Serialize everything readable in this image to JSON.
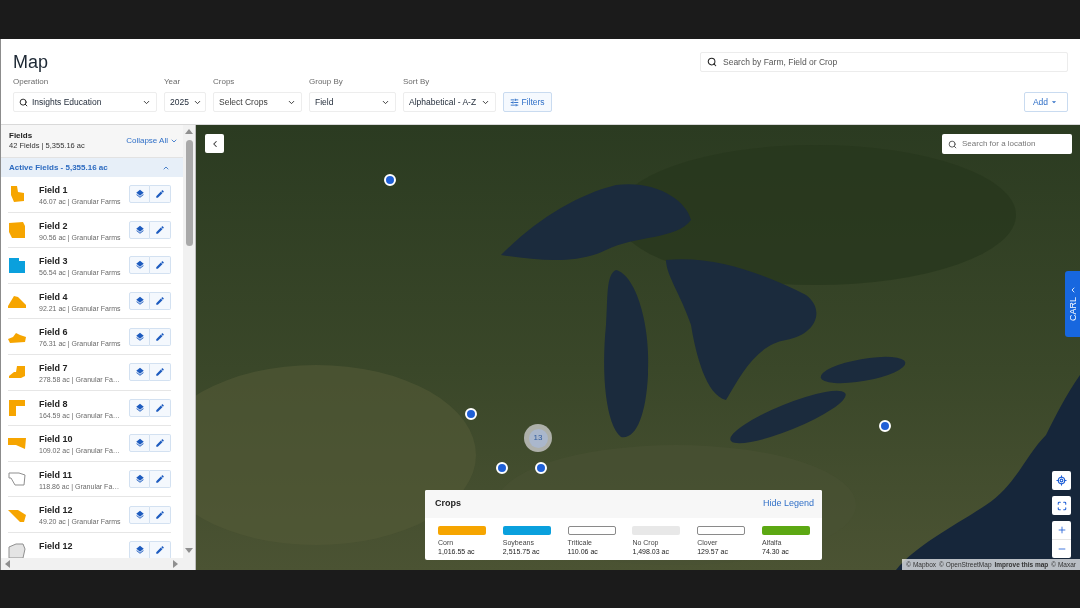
{
  "header": {
    "title": "Map",
    "search": {
      "placeholder": "Search by Farm, Field or Crop"
    },
    "add_button": "Add"
  },
  "filters": [
    {
      "kind": "search-select",
      "label": "Operation",
      "value": "Insights Education"
    },
    {
      "kind": "select",
      "label": "Year",
      "value": "2025"
    },
    {
      "kind": "select",
      "label": "Crops",
      "placeholder": "Select Crops"
    },
    {
      "kind": "select",
      "label": "Group By",
      "value": "Field"
    },
    {
      "kind": "select",
      "label": "Sort By",
      "value": "Alphabetical - A-Z"
    }
  ],
  "filters_button": "Filters",
  "sidebar": {
    "title": "Fields",
    "summary": "42 Fields | 5,355.16 ac",
    "collapse_all": "Collapse All",
    "groups": [
      {
        "label": "Active Fields - 5,355.16 ac",
        "expanded": true,
        "fields": [
          {
            "name": "Field 1",
            "details": "46.07 ac | Granular Farms",
            "color": "#f6a500"
          },
          {
            "name": "Field 2",
            "details": "90.56 ac | Granular Farms",
            "color": "#f6a500"
          },
          {
            "name": "Field 3",
            "details": "56.54 ac | Granular Farms",
            "color": "#0aa0dd"
          },
          {
            "name": "Field 4",
            "details": "92.21 ac | Granular Farms",
            "color": "#f6a500"
          },
          {
            "name": "Field 6",
            "details": "76.31 ac | Granular Farms",
            "color": "#f6a500"
          },
          {
            "name": "Field 7",
            "details": "278.58 ac | Granular Fa…",
            "color": "#f6a500"
          },
          {
            "name": "Field 8",
            "details": "164.59 ac | Granular Fa…",
            "color": "#f6a500"
          },
          {
            "name": "Field 10",
            "details": "109.02 ac | Granular Fa…",
            "color": "#f6a500"
          },
          {
            "name": "Field 11",
            "details": "118.86 ac | Granular Fa…",
            "color": "#ffffff"
          },
          {
            "name": "Field 12",
            "details": "49.20 ac | Granular Farms",
            "color": "#f6a500"
          },
          {
            "name": "Field 12",
            "color": "#e4e4e4"
          }
        ]
      }
    ]
  },
  "map": {
    "location_search": {
      "placeholder": "Search for a location"
    },
    "carl_tab": "CARL",
    "clusters": [
      {
        "count": "13"
      }
    ],
    "legend": {
      "title": "Crops",
      "hide_link": "Hide Legend",
      "items": [
        {
          "name": "Corn",
          "acreage": "1,016.55 ac",
          "color": "#f6a500"
        },
        {
          "name": "Soybeans",
          "acreage": "2,515.75 ac",
          "color": "#0aa0dd"
        },
        {
          "name": "Triticale",
          "acreage": "110.06 ac",
          "color": "#ffffff"
        },
        {
          "name": "No Crop",
          "acreage": "1,498.03 ac",
          "color": "#e8e8e8"
        },
        {
          "name": "Clover",
          "acreage": "129.57 ac",
          "color": "#ffffff"
        },
        {
          "name": "Alfalfa",
          "acreage": "74.30 ac",
          "color": "#5ca813"
        }
      ]
    },
    "attribution": [
      {
        "kind": "credit",
        "text": "© Mapbox"
      },
      {
        "kind": "credit",
        "text": "© OpenStreetMap"
      },
      {
        "kind": "feedback",
        "text": "Improve this map"
      },
      {
        "kind": "credit",
        "text": "© Maxar"
      }
    ]
  }
}
